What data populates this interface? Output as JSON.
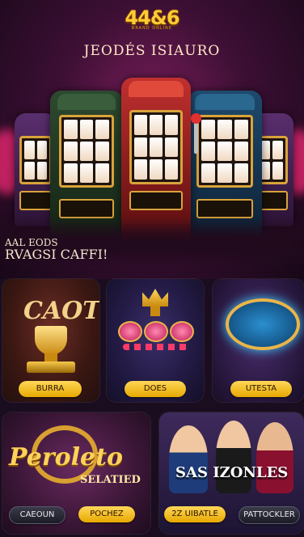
{
  "header": {
    "logo_text": "44&6",
    "logo_subtext": "BRAND ONLINE",
    "title": "JEODÉS ISIAURO"
  },
  "hero": {
    "slogan_line1": "AAL EODS",
    "slogan_line2": "RVAGSI CAFFI!"
  },
  "cards": [
    {
      "art_text": "CAOT",
      "button_label": "BURRA"
    },
    {
      "button_label": "DOES"
    },
    {
      "button_label": "UTESTA"
    },
    {
      "art_text_line1": "Peroleto",
      "art_text_line2": "SELATIED",
      "buttons": [
        "CAEOUN",
        "POCHEZ"
      ]
    },
    {
      "art_text": "SAS IZONLES",
      "buttons": [
        "2Z UIBATLE",
        "PATTOCKLER"
      ]
    }
  ],
  "colors": {
    "accent_gold": "#ffcc33",
    "button_gold": "#e7a800",
    "background": "#1a0d1f"
  }
}
